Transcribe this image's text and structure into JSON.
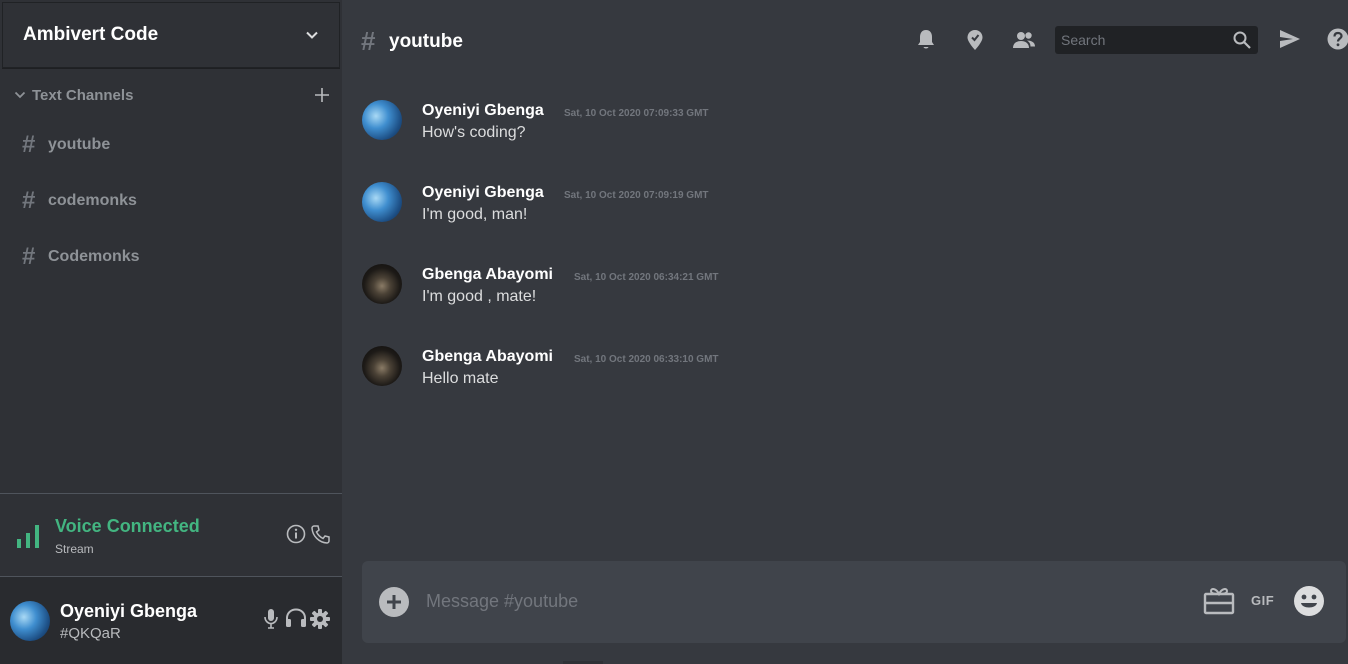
{
  "server": {
    "name": "Ambivert Code"
  },
  "category": {
    "label": "Text Channels"
  },
  "channels": [
    {
      "label": "youtube"
    },
    {
      "label": "codemonks"
    },
    {
      "label": "Codemonks"
    }
  ],
  "voice": {
    "title": "Voice Connected",
    "subtitle": "Stream",
    "color": "#43b581"
  },
  "user": {
    "name": "Oyeniyi Gbenga",
    "tag": "#QKQaR"
  },
  "header": {
    "hash": "#",
    "channel": "youtube",
    "search_placeholder": "Search"
  },
  "messages": [
    {
      "author": "Oyeniyi Gbenga",
      "time": "Sat, 10 Oct 2020 07:09:33 GMT",
      "text": "How's coding?",
      "avatar": "blue-planet"
    },
    {
      "author": "Oyeniyi Gbenga",
      "time": "Sat, 10 Oct 2020 07:09:19 GMT",
      "text": "I'm good, man!",
      "avatar": "blue-planet"
    },
    {
      "author": "Gbenga Abayomi",
      "time": "Sat, 10 Oct 2020 06:34:21 GMT",
      "text": "I'm good , mate!",
      "avatar": "dark-tower"
    },
    {
      "author": "Gbenga Abayomi",
      "time": "Sat, 10 Oct 2020 06:33:10 GMT",
      "text": "Hello mate",
      "avatar": "dark-tower"
    }
  ],
  "composer": {
    "placeholder": "Message #youtube",
    "gif_label": "GIF"
  },
  "icons": [
    "chevron-down-icon",
    "plus-icon",
    "hash-icon",
    "signal-icon",
    "info-icon",
    "phone-icon",
    "mic-icon",
    "headphones-icon",
    "gear-icon",
    "bell-icon",
    "pin-icon",
    "members-icon",
    "search-icon",
    "send-icon",
    "help-icon",
    "add-circle-icon",
    "gift-icon",
    "emoji-icon"
  ]
}
